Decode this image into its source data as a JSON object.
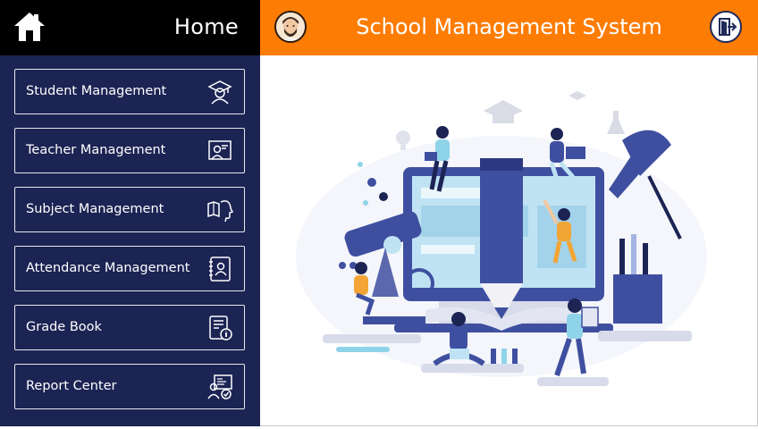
{
  "header": {
    "home_label": "Home",
    "app_title": "School Management System"
  },
  "sidebar": {
    "items": [
      {
        "label": "Student Management",
        "icon": "student-icon"
      },
      {
        "label": "Teacher Management",
        "icon": "teacher-icon"
      },
      {
        "label": "Subject Management",
        "icon": "subject-icon"
      },
      {
        "label": "Attendance Management",
        "icon": "attendance-icon"
      },
      {
        "label": "Grade Book",
        "icon": "gradebook-icon"
      },
      {
        "label": "Report Center",
        "icon": "report-icon"
      }
    ]
  },
  "colors": {
    "orange": "#fd7c03",
    "navy": "#1c2454",
    "black": "#000000",
    "illustration_blue": "#3f4fa0",
    "screen_blue": "#bfe3f3"
  },
  "icons": {
    "home": "home-icon",
    "avatar": "user-avatar",
    "logout": "logout-icon"
  }
}
